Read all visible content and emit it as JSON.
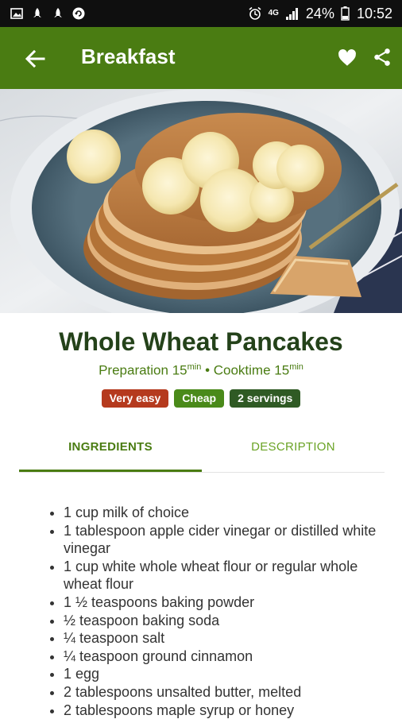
{
  "status_bar": {
    "left_icons": [
      "image-icon",
      "rocket-icon",
      "rocket-icon",
      "sync-icon"
    ],
    "signal_label": "4G",
    "battery": "24%",
    "time": "10:52"
  },
  "app_bar": {
    "title": "Breakfast",
    "background": "#4a7c12"
  },
  "recipe": {
    "title": "Whole Wheat Pancakes",
    "prep_label": "Preparation 15",
    "prep_unit": "min",
    "separator": " • ",
    "cook_label": "Cooktime 15",
    "cook_unit": "min",
    "badges": [
      {
        "label": "Very easy",
        "color": "#b53a1e"
      },
      {
        "label": "Cheap",
        "color": "#4a8a1a"
      },
      {
        "label": "2 servings",
        "color": "#2f5a24"
      }
    ]
  },
  "tabs": [
    {
      "label": "INGREDIENTS",
      "active": true
    },
    {
      "label": "DESCRIPTION",
      "active": false
    }
  ],
  "ingredients": [
    "1 cup milk of choice",
    "1 tablespoon apple cider vinegar or distilled white vinegar",
    "1 cup white whole wheat flour or regular whole wheat flour",
    "1 ½ teaspoons baking powder",
    "½ teaspoon baking soda",
    "¼ teaspoon salt",
    "¼ teaspoon ground cinnamon",
    "1 egg",
    "2 tablespoons unsalted butter, melted",
    "2 tablespoons maple syrup or honey"
  ],
  "colors": {
    "accent": "#4a7c12",
    "title_text": "#24421a",
    "body_text": "#333333"
  }
}
